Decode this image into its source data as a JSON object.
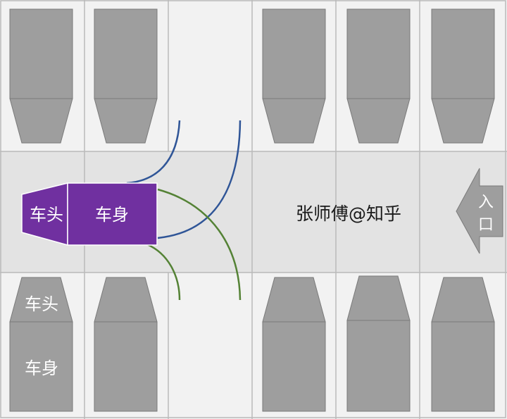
{
  "labels": {
    "car_head": "车头",
    "car_body": "车身",
    "parked_head": "车头",
    "parked_body": "车身",
    "watermark": "张师傅@知乎",
    "entrance": "入口"
  },
  "colors": {
    "background_cell": "#f2f2f2",
    "aisle": "#e3e3e3",
    "grid_line": "#b9b9b9",
    "parked_car": "#9e9e9e",
    "parked_car_stroke": "#7a7a7a",
    "moving_car": "#7030a0",
    "curve_blue": "#2f5597",
    "curve_green": "#548235",
    "arrow": "#9e9e9e"
  },
  "icons": {
    "entrance": "arrow-left-icon"
  }
}
